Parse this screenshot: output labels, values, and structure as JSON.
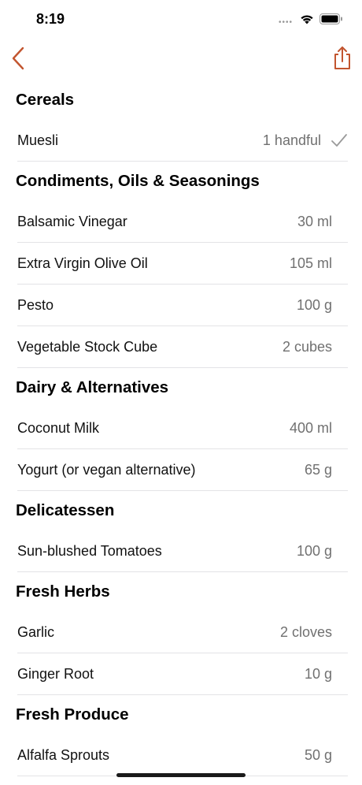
{
  "status_bar": {
    "time": "8:19",
    "signal_dots": "••••",
    "icons": [
      "wifi-icon",
      "battery-icon"
    ]
  },
  "nav": {
    "back_icon": "chevron-left-icon",
    "share_icon": "share-icon"
  },
  "colors": {
    "accent": "#c2552f",
    "separator": "#e3e3e6",
    "quantity_text": "#707070"
  },
  "sections": [
    {
      "title": "Cereals",
      "items": [
        {
          "name": "Muesli",
          "quantity": "1 handful",
          "checked": true
        }
      ]
    },
    {
      "title": "Condiments, Oils & Seasonings",
      "items": [
        {
          "name": "Balsamic Vinegar",
          "quantity": "30 ml"
        },
        {
          "name": "Extra Virgin Olive Oil",
          "quantity": "105 ml"
        },
        {
          "name": "Pesto",
          "quantity": "100 g"
        },
        {
          "name": "Vegetable Stock Cube",
          "quantity": "2 cubes"
        }
      ]
    },
    {
      "title": "Dairy & Alternatives",
      "items": [
        {
          "name": "Coconut Milk",
          "quantity": "400 ml"
        },
        {
          "name": "Yogurt (or vegan alternative)",
          "quantity": "65 g"
        }
      ]
    },
    {
      "title": "Delicatessen",
      "items": [
        {
          "name": "Sun-blushed Tomatoes",
          "quantity": "100 g"
        }
      ]
    },
    {
      "title": "Fresh Herbs",
      "items": [
        {
          "name": "Garlic",
          "quantity": "2 cloves"
        },
        {
          "name": "Ginger Root",
          "quantity": "10 g"
        }
      ]
    },
    {
      "title": "Fresh Produce",
      "items": [
        {
          "name": "Alfalfa Sprouts",
          "quantity": "50 g"
        }
      ]
    }
  ]
}
